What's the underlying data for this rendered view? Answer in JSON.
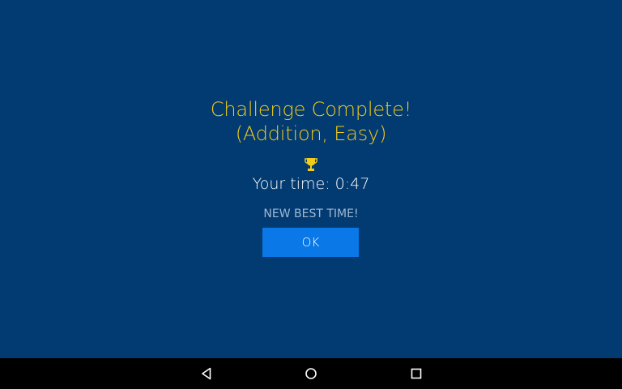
{
  "dialog": {
    "title_line1": "Challenge Complete!",
    "title_line2": "(Addition, Easy)",
    "trophy_icon": "trophy-icon",
    "time_text": "Your time: 0:47",
    "best_text": "NEW BEST TIME!",
    "ok_label": "OK"
  },
  "nav": {
    "back_icon": "back-icon",
    "home_icon": "home-icon",
    "recent_icon": "recent-apps-icon"
  },
  "colors": {
    "background": "#023a72",
    "title": "#f2cc19",
    "button": "#0a78e6",
    "best_text": "#9fb8d2",
    "navbar": "#000000"
  }
}
